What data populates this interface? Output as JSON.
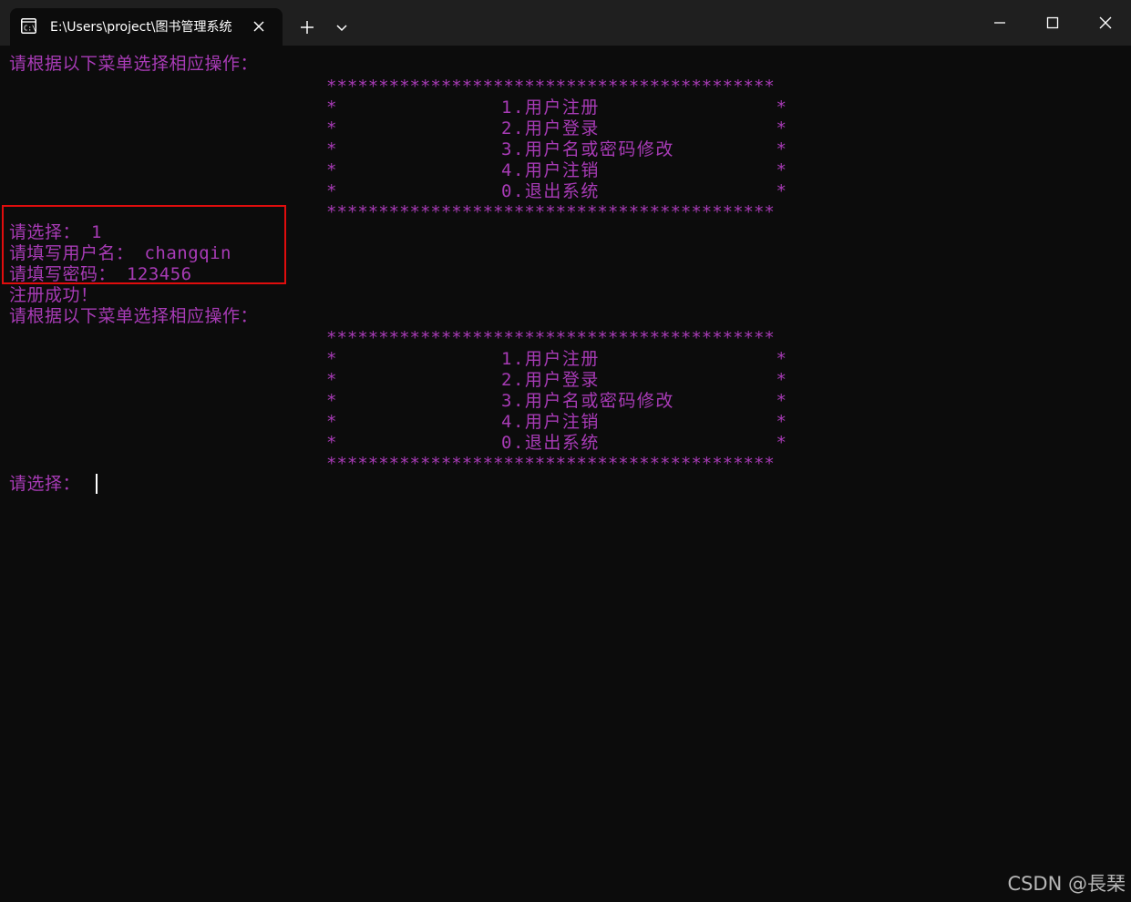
{
  "window": {
    "tab_title": "E:\\Users\\project\\图书管理系统",
    "icons": {
      "tab": "terminal-app-icon",
      "close_tab": "close-icon",
      "new_tab": "plus-icon",
      "dropdown": "chevron-down-icon",
      "minimize": "minimize-icon",
      "maximize": "maximize-icon",
      "close": "close-icon"
    }
  },
  "terminal": {
    "text_color": "#a83bb6",
    "background": "#0c0c0c",
    "prompt_menu": "请根据以下菜单选择相应操作：",
    "stars_line": "*******************************************",
    "menu_items": [
      "1.用户注册",
      "2.用户登录",
      "3.用户名或密码修改",
      "4.用户注销",
      "0.退出系统"
    ],
    "session": {
      "select_line": "请选择： 1",
      "username_line": "请填写用户名： changqin",
      "password_line": "请填写密码： 123456",
      "success_line": "注册成功！",
      "prompt_menu_2": "请根据以下菜单选择相应操作：",
      "select_prompt": "请选择："
    },
    "highlight_color": "#e00d0d"
  },
  "watermark": "CSDN @長琹"
}
